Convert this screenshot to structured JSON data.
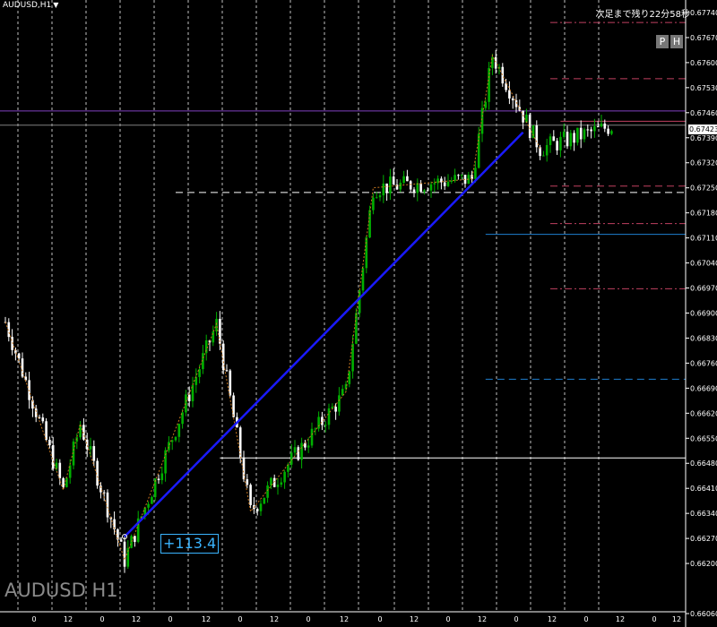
{
  "header": {
    "symbol_timeframe": "AUDUSD,H1",
    "dropdown_glyph": "▼",
    "countdown": "次足まで残り22分58秒"
  },
  "buttons": {
    "p_label": "P",
    "h_label": "H"
  },
  "watermark": "AUDUSD H1",
  "trendline_label": "+113.4",
  "current_price_label": "0.67423",
  "colors": {
    "background": "#000000",
    "bull_candle": "#00b000",
    "bear_candle": "#ffffff",
    "trendline": "#1a1aff",
    "zigzag": "#c87820",
    "grid": "#ffffff",
    "violet_line": "#8040c0",
    "price_line": "#808080"
  },
  "chart_data": {
    "type": "candlestick",
    "symbol": "AUDUSD",
    "timeframe": "H1",
    "y_ticks": [
      "0.67740",
      "0.67670",
      "0.67600",
      "0.67530",
      "0.67460",
      "0.67390",
      "0.67320",
      "0.67250",
      "0.67180",
      "0.67110",
      "0.67040",
      "0.66970",
      "0.66900",
      "0.66830",
      "0.66760",
      "0.66690",
      "0.66620",
      "0.66550",
      "0.66480",
      "0.66410",
      "0.66340",
      "0.66270",
      "0.66200",
      "0.66060"
    ],
    "x_ticks": [
      "0",
      "12",
      "0",
      "12",
      "0",
      "12",
      "0",
      "12",
      "0",
      "12",
      "0",
      "12",
      "0",
      "12",
      "0",
      "12",
      "0",
      "12",
      "0",
      "12"
    ],
    "y_range": [
      0.66065,
      0.67775
    ],
    "current_price": 0.67423,
    "candles": [],
    "zigzag": [
      [
        0,
        0.66875
      ],
      [
        17,
        0.66405
      ],
      [
        22,
        0.6659
      ],
      [
        35,
        0.6621
      ],
      [
        62,
        0.6687
      ],
      [
        72,
        0.66345
      ],
      [
        100,
        0.6668
      ],
      [
        108,
        0.6725
      ],
      [
        137,
        0.67275
      ],
      [
        143,
        0.6762
      ],
      [
        157,
        0.6736
      ]
    ],
    "trendline": {
      "from": [
        35,
        0.66275
      ],
      "to": [
        152,
        0.67405
      ],
      "label": "+113.4"
    },
    "horizontal_lines": [
      {
        "price": 0.67465,
        "color": "#8040c0",
        "style": "solid",
        "from_bar": 0
      },
      {
        "price": 0.67425,
        "color": "#808080",
        "style": "solid",
        "from_bar": 0
      },
      {
        "price": 0.67237,
        "color": "#ffffff",
        "style": "dashed",
        "from_bar": 50
      },
      {
        "price": 0.66495,
        "color": "#ffffff",
        "style": "solid",
        "from_bar": 63
      },
      {
        "price": 0.67712,
        "color": "#c04060",
        "style": "dashdot",
        "from_bar": 160
      },
      {
        "price": 0.67555,
        "color": "#c04060",
        "style": "dashed",
        "from_bar": 160
      },
      {
        "price": 0.67436,
        "color": "#c04060",
        "style": "solid",
        "from_bar": 163
      },
      {
        "price": 0.67255,
        "color": "#c04060",
        "style": "dashed",
        "from_bar": 160
      },
      {
        "price": 0.6715,
        "color": "#c04060",
        "style": "dashdot",
        "from_bar": 160
      },
      {
        "price": 0.6712,
        "color": "#1e7fd0",
        "style": "solid",
        "from_bar": 141
      },
      {
        "price": 0.66968,
        "color": "#c04060",
        "style": "dashdot",
        "from_bar": 160
      },
      {
        "price": 0.66715,
        "color": "#1e7fd0",
        "style": "dashed",
        "from_bar": 141
      }
    ]
  }
}
